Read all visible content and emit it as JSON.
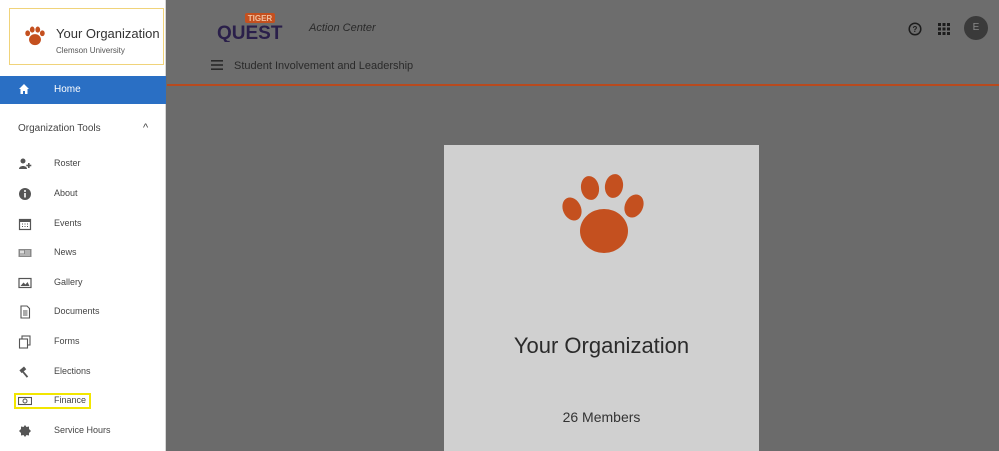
{
  "org": {
    "name": "Your Organization",
    "university": "Clemson University",
    "members": "26 Members"
  },
  "sidebar": {
    "home_label": "Home",
    "section_label": "Organization Tools",
    "items": [
      {
        "label": "Roster",
        "icon": "add-user-icon"
      },
      {
        "label": "About",
        "icon": "info-icon"
      },
      {
        "label": "Events",
        "icon": "calendar-icon"
      },
      {
        "label": "News",
        "icon": "news-icon"
      },
      {
        "label": "Gallery",
        "icon": "image-icon"
      },
      {
        "label": "Documents",
        "icon": "document-icon"
      },
      {
        "label": "Forms",
        "icon": "forms-icon"
      },
      {
        "label": "Elections",
        "icon": "gavel-icon"
      },
      {
        "label": "Finance",
        "icon": "money-icon"
      },
      {
        "label": "Service Hours",
        "icon": "badge-icon"
      }
    ]
  },
  "header": {
    "logo_text_top": "TIGER",
    "logo_text_main": "QUEST",
    "action_center": "Action Center",
    "breadcrumb": "Student Involvement and Leadership",
    "avatar_initial": "E"
  },
  "colors": {
    "accent_blue": "#2a6fc4",
    "clemson_orange": "#c4501f",
    "highlight_yellow": "#f2e600"
  }
}
